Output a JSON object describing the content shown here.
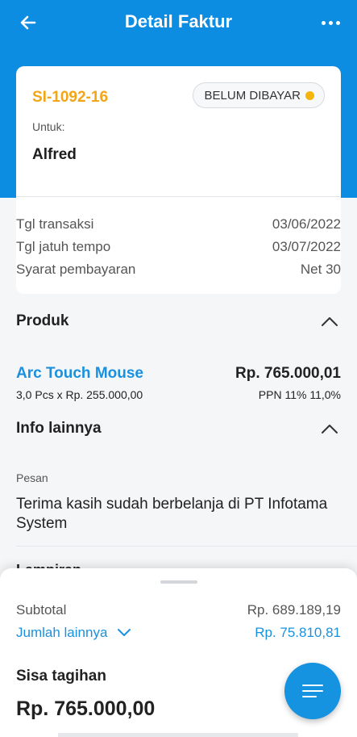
{
  "header": {
    "title": "Detail Faktur"
  },
  "invoice": {
    "number": "SI-1092-16",
    "status": "BELUM DIBAYAR",
    "for_label": "Untuk:",
    "customer": "Alfred",
    "details": [
      {
        "label": "Tgl transaksi",
        "value": "03/06/2022"
      },
      {
        "label": "Tgl jatuh tempo",
        "value": "03/07/2022"
      },
      {
        "label": "Syarat pembayaran",
        "value": "Net 30"
      }
    ]
  },
  "products": {
    "title": "Produk",
    "items": [
      {
        "name": "Arc Touch Mouse",
        "price": "Rp. 765.000,01",
        "qty": "3,0 Pcs x Rp. 255.000,00",
        "tax": "PPN 11% 11,0%"
      }
    ]
  },
  "other_info": {
    "title": "Info lainnya",
    "message_label": "Pesan",
    "message": "Terima kasih sudah berbelanja di PT Infotama System",
    "next_section_partial": "Lampiran"
  },
  "summary": {
    "subtotal_label": "Subtotal",
    "subtotal_value": "Rp.  689.189,19",
    "other_label": "Jumlah lainnya",
    "other_value": "Rp. 75.810,81",
    "remaining_label": "Sisa tagihan",
    "remaining_value": "Rp.  765.000,00"
  },
  "colors": {
    "primary": "#0d8de2",
    "link": "#1a91de",
    "invoice_number": "#f2a516",
    "status_dot": "#f5b50a"
  }
}
